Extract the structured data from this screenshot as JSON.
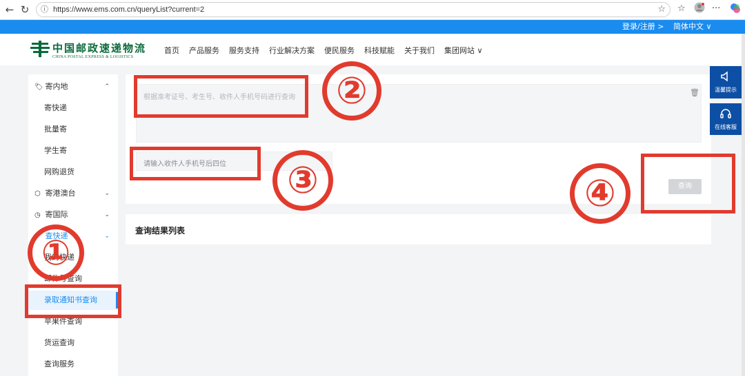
{
  "browser": {
    "back_icon": "arrow-left-icon",
    "reload_icon": "reload-icon",
    "url": "https://www.ems.com.cn/queryList?current=2",
    "tools": [
      "star-icon",
      "favorites-icon",
      "profile-icon",
      "more-icon",
      "copilot-icon"
    ],
    "more_label": "···"
  },
  "topbar": {
    "login": "登录/注册 >",
    "language": "简体中文 ∨"
  },
  "header": {
    "logo_cn": "中国邮政速递物流",
    "logo_en": "CHINA POSTAL EXPRESS & LOGISTICS",
    "nav": [
      "首页",
      "产品服务",
      "服务支持",
      "行业解决方案",
      "便民服务",
      "科技赋能",
      "关于我们",
      "集团网站 ∨"
    ]
  },
  "sidebar": {
    "items": [
      {
        "label": "寄内地",
        "type": "group",
        "icon": "tag-icon",
        "chev": "⌃"
      },
      {
        "label": "寄快递",
        "type": "sub"
      },
      {
        "label": "批量寄",
        "type": "sub"
      },
      {
        "label": "学生寄",
        "type": "sub"
      },
      {
        "label": "网购退货",
        "type": "sub"
      },
      {
        "label": "寄港澳台",
        "type": "group",
        "icon": "cube-icon",
        "chev": "⌄"
      },
      {
        "label": "寄国际",
        "type": "group",
        "icon": "globe-icon",
        "chev": "⌄"
      },
      {
        "label": "查快递",
        "type": "group",
        "icon": "search-icon",
        "chev": "⌄"
      },
      {
        "label": "我的快递",
        "type": "sub"
      },
      {
        "label": "邮件号查询",
        "type": "sub"
      },
      {
        "label": "录取通知书查询",
        "type": "sub",
        "selected": true
      },
      {
        "label": "苹果件查询",
        "type": "sub"
      },
      {
        "label": "货运查询",
        "type": "sub"
      },
      {
        "label": "查询服务",
        "type": "sub"
      }
    ]
  },
  "form": {
    "textarea_placeholder": "根据准考证号、考生号、收件人手机号码进行查询",
    "phone_placeholder": "请输入收件人手机号后四位",
    "query_button": "查询",
    "clear_icon": "trash-icon"
  },
  "results": {
    "title": "查询结果列表"
  },
  "floating": [
    {
      "label": "温馨提示",
      "icon": "speaker-icon"
    },
    {
      "label": "在线客服",
      "icon": "headset-icon"
    }
  ],
  "annotations": [
    "①",
    "②",
    "③",
    "④"
  ],
  "colors": {
    "brand_blue": "#1a8cf0",
    "brand_green": "#0a6a3b",
    "annotation_red": "#e13b2e",
    "float_blue": "#0d4fa5"
  }
}
